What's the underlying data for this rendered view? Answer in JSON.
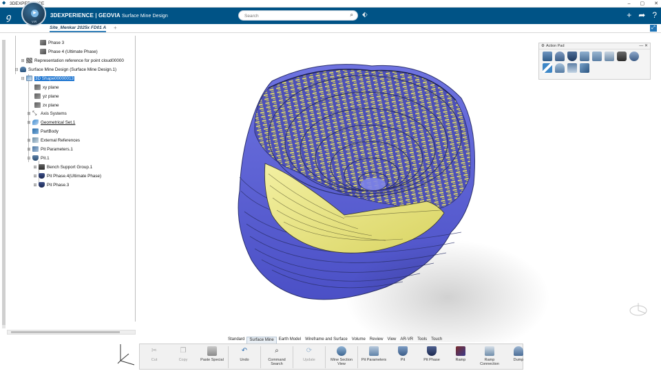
{
  "window": {
    "title": "3DEXPERIENCE",
    "controls": [
      "–",
      "▢",
      "✕"
    ]
  },
  "topbar": {
    "brand_prefix": "3DEXPERIENCE | GEOVIA",
    "app_name": "Surface Mine Design",
    "compass_version": "V.R",
    "search_placeholder": "Search",
    "accent_color": "#005386"
  },
  "tabstrip": {
    "document_tab": "Site_Menkar 2025x FD01 A",
    "add_tab": "+"
  },
  "tree": {
    "nodes": [
      {
        "label": "Phase 3",
        "icon": "phase-icon"
      },
      {
        "label": "Phase 4 (Ultimate Phase)",
        "icon": "phase-icon"
      },
      {
        "label": "Representation reference for point cloud00000",
        "icon": "point-cloud-icon"
      },
      {
        "label": "Surface Mine Design (Surface Mine Design.1)",
        "icon": "mine-design-icon"
      },
      {
        "label": "3D Shape00000013",
        "icon": "3d-shape-icon",
        "selected": true
      },
      {
        "label": "xy plane",
        "icon": "plane-icon"
      },
      {
        "label": "yz plane",
        "icon": "plane-icon"
      },
      {
        "label": "zx plane",
        "icon": "plane-icon"
      },
      {
        "label": "Axis Systems",
        "icon": "axis-system-icon"
      },
      {
        "label": "Geometrical Set.1",
        "icon": "geometrical-set-icon"
      },
      {
        "label": "PartBody",
        "icon": "part-body-icon"
      },
      {
        "label": "External References",
        "icon": "external-references-icon"
      },
      {
        "label": "Pit Parameters.1",
        "icon": "pit-parameters-icon"
      },
      {
        "label": "Pit.1",
        "icon": "pit-icon"
      },
      {
        "label": "Bench Support Group.1",
        "icon": "bench-support-icon"
      },
      {
        "label": "Pit Phase.4(Ultimate Phase)",
        "icon": "pit-phase-icon"
      },
      {
        "label": "Pit Phase.3",
        "icon": "pit-phase-icon"
      }
    ]
  },
  "action_pad": {
    "title": "Action Pad"
  },
  "toolbar": {
    "tabs": [
      "Standard",
      "Surface Mine",
      "Earth Model",
      "Wireframe and Surface",
      "Volume",
      "Review",
      "View",
      "AR-VR",
      "Tools",
      "Touch"
    ],
    "active_tab": "Surface Mine",
    "buttons": [
      {
        "label": "Cut",
        "icon": "scissors-icon",
        "enabled": false
      },
      {
        "label": "Copy",
        "icon": "copy-icon",
        "enabled": false
      },
      {
        "label": "Paste Special",
        "icon": "paste-icon",
        "enabled": true
      },
      {
        "label": "Undo",
        "icon": "undo-icon",
        "enabled": true
      },
      {
        "label": "Command Search",
        "icon": "command-search-icon",
        "enabled": true
      },
      {
        "label": "Update",
        "icon": "update-icon",
        "enabled": false
      },
      {
        "label": "Mine Section View",
        "icon": "mine-section-view-icon",
        "enabled": true
      },
      {
        "label": "Pit Parameters",
        "icon": "pit-parameters-icon",
        "enabled": true
      },
      {
        "label": "Pit",
        "icon": "pit-icon",
        "enabled": true
      },
      {
        "label": "Pit Phase",
        "icon": "pit-phase-icon",
        "enabled": true
      },
      {
        "label": "Ramp",
        "icon": "ramp-icon",
        "enabled": true
      },
      {
        "label": "Ramp Connection",
        "icon": "ramp-connection-icon",
        "enabled": true
      },
      {
        "label": "Dump",
        "icon": "dump-icon",
        "enabled": true
      }
    ]
  },
  "model_colors": {
    "pit_blue": "#5a5fd0",
    "phase_yellow": "#e8e47a",
    "dark_bench": "#2a2f6b"
  }
}
